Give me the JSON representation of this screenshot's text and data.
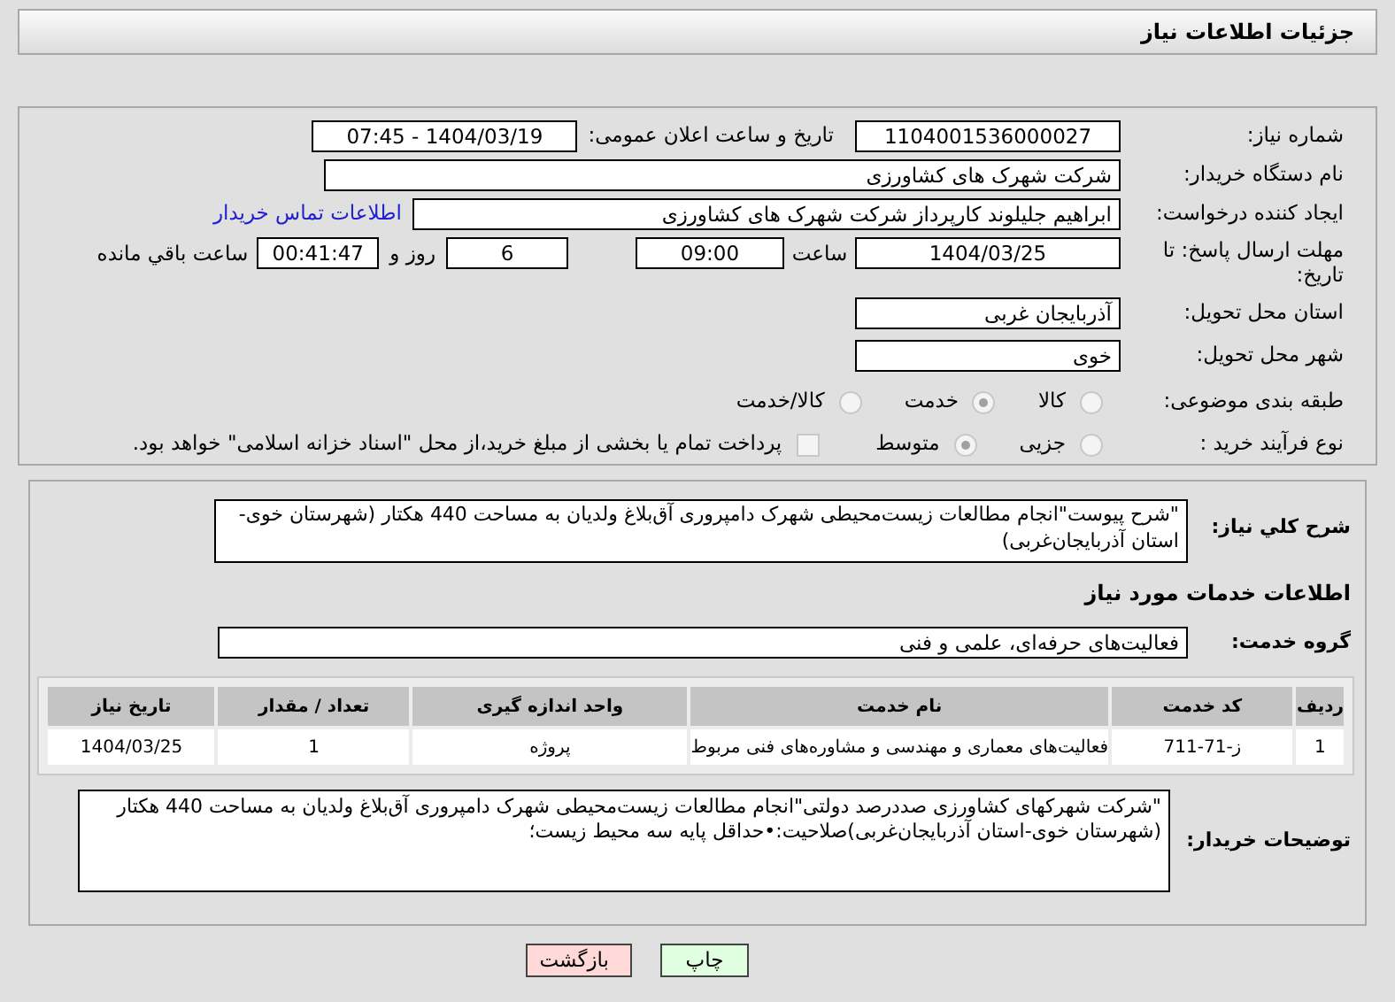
{
  "header": {
    "title": "جزئیات اطلاعات نیاز"
  },
  "fields": {
    "need_number": {
      "label": "شماره نیاز:",
      "value": "1104001536000027"
    },
    "announce": {
      "label": "تاریخ و ساعت اعلان عمومی:",
      "value": "1404/03/19 - 07:45"
    },
    "buyer": {
      "label": "نام دستگاه خریدار:",
      "value": "شرکت شهرک های کشاورزی"
    },
    "creator": {
      "label": "ایجاد کننده درخواست:",
      "value": "ابراهیم جلیلوند کارپرداز شرکت شهرک های کشاورزی",
      "link": "اطلاعات تماس خریدار"
    },
    "deadline": {
      "label": "مهلت ارسال پاسخ: تا تاریخ:",
      "date": "1404/03/25",
      "time_label": "ساعت",
      "time": "09:00",
      "days": "6",
      "days_label": "روز و",
      "remaining": "00:41:47",
      "remaining_label": "ساعت باقي مانده"
    },
    "province": {
      "label": "استان محل تحویل:",
      "value": "آذربایجان غربی"
    },
    "city": {
      "label": "شهر محل تحویل:",
      "value": "خوی"
    }
  },
  "category": {
    "label": "طبقه بندی موضوعی:",
    "options": [
      {
        "label": "کالا",
        "selected": false
      },
      {
        "label": "خدمت",
        "selected": true
      },
      {
        "label": "کالا/خدمت",
        "selected": false
      }
    ]
  },
  "process": {
    "label": "نوع فرآیند خرید :",
    "options": [
      {
        "label": "جزیی",
        "selected": false
      },
      {
        "label": "متوسط",
        "selected": true
      }
    ],
    "treasury": {
      "label": "پرداخت تمام یا بخشی از مبلغ خرید،از محل \"اسناد خزانه اسلامی\" خواهد بود.",
      "checked": false
    }
  },
  "description": {
    "label": "شرح کلي نیاز:",
    "value": "\"شرح پیوست\"انجام مطالعات زیست‌محیطی شهرک دامپروری آق‌بلاغ ولدیان به مساحت 440 هکتار (شهرستان خوی-استان آذربایجان‌غربی)"
  },
  "services_title": "اطلاعات خدمات مورد نیاز",
  "service_group": {
    "label": "گروه خدمت:",
    "value": "فعالیت‌های حرفه‌ای، علمی و فنی"
  },
  "table": {
    "columns": [
      "ردیف",
      "کد خدمت",
      "نام خدمت",
      "واحد اندازه گیری",
      "تعداد / مقدار",
      "تاریخ نیاز"
    ],
    "rows": [
      [
        "1",
        "ز-71-711",
        "فعالیت‌های معماری و مهندسی و مشاوره‌های فنی مربوط",
        "پروژه",
        "1",
        "1404/03/25"
      ]
    ]
  },
  "notes": {
    "label": "توضیحات خریدار:",
    "value": "\"شرکت شهرکهای کشاورزی صددرصد دولتی\"انجام مطالعات زیست‌محیطی شهرک دامپروری آق‌بلاغ ولدیان به مساحت 440 هکتار (شهرستان خوی-استان آذربایجان‌غربی)صلاحیت:•حداقل پایه سه محیط زیست؛"
  },
  "buttons": [
    {
      "label": "چاپ",
      "kind": "print"
    },
    {
      "label": "بازگشت",
      "kind": "back"
    }
  ]
}
